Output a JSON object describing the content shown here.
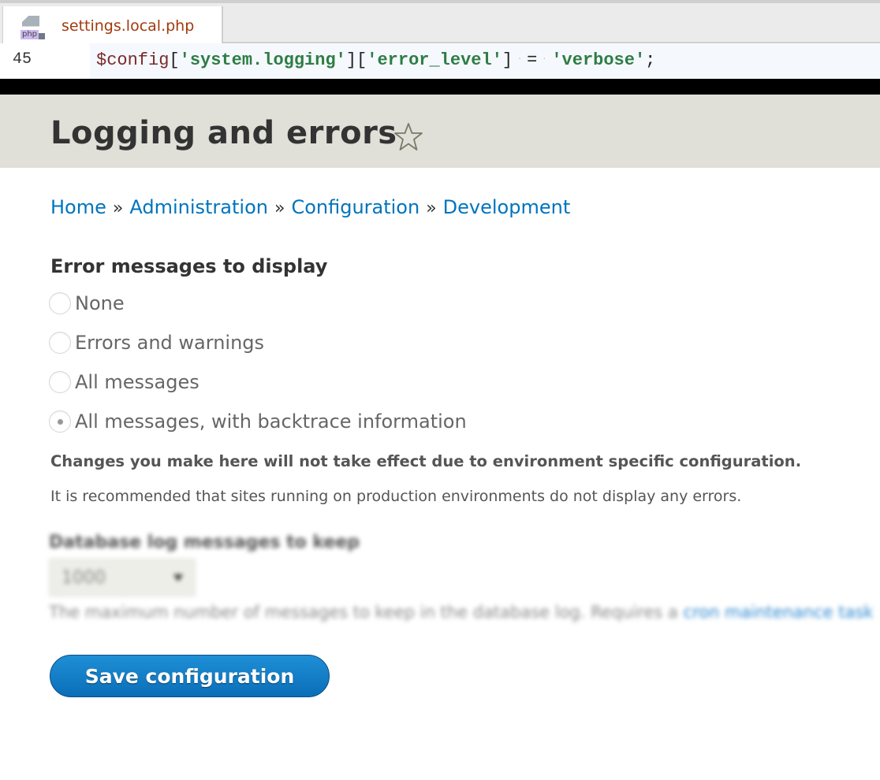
{
  "editor": {
    "tab_title": "settings.local.php",
    "file_badge": "php",
    "line_number": "45",
    "code": {
      "var": "$config",
      "key1": "'system.logging'",
      "key2": "'error_level'",
      "op": "=",
      "value": "'verbose'",
      "end": ";"
    }
  },
  "page": {
    "title": "Logging and errors",
    "breadcrumb": [
      "Home",
      "Administration",
      "Configuration",
      "Development"
    ],
    "breadcrumb_separator": "»",
    "error_display": {
      "legend": "Error messages to display",
      "options": [
        {
          "label": "None",
          "checked": false
        },
        {
          "label": "Errors and warnings",
          "checked": false
        },
        {
          "label": "All messages",
          "checked": false
        },
        {
          "label": "All messages, with backtrace information",
          "checked": true
        }
      ],
      "warning": "Changes you make here will not take effect due to environment specific configuration.",
      "description": "It is recommended that sites running on production environments do not display any errors."
    },
    "db_log": {
      "label": "Database log messages to keep",
      "selected": "1000",
      "help": "The maximum number of messages to keep in the database log. Requires a ",
      "help_link": "cron maintenance task"
    },
    "save_label": "Save configuration"
  },
  "colors": {
    "link": "#0074bd",
    "button": "#0a6eb8",
    "header_bg": "#e0e0d8",
    "tab_title": "#a23a0c",
    "code_string": "#2e7d44"
  }
}
